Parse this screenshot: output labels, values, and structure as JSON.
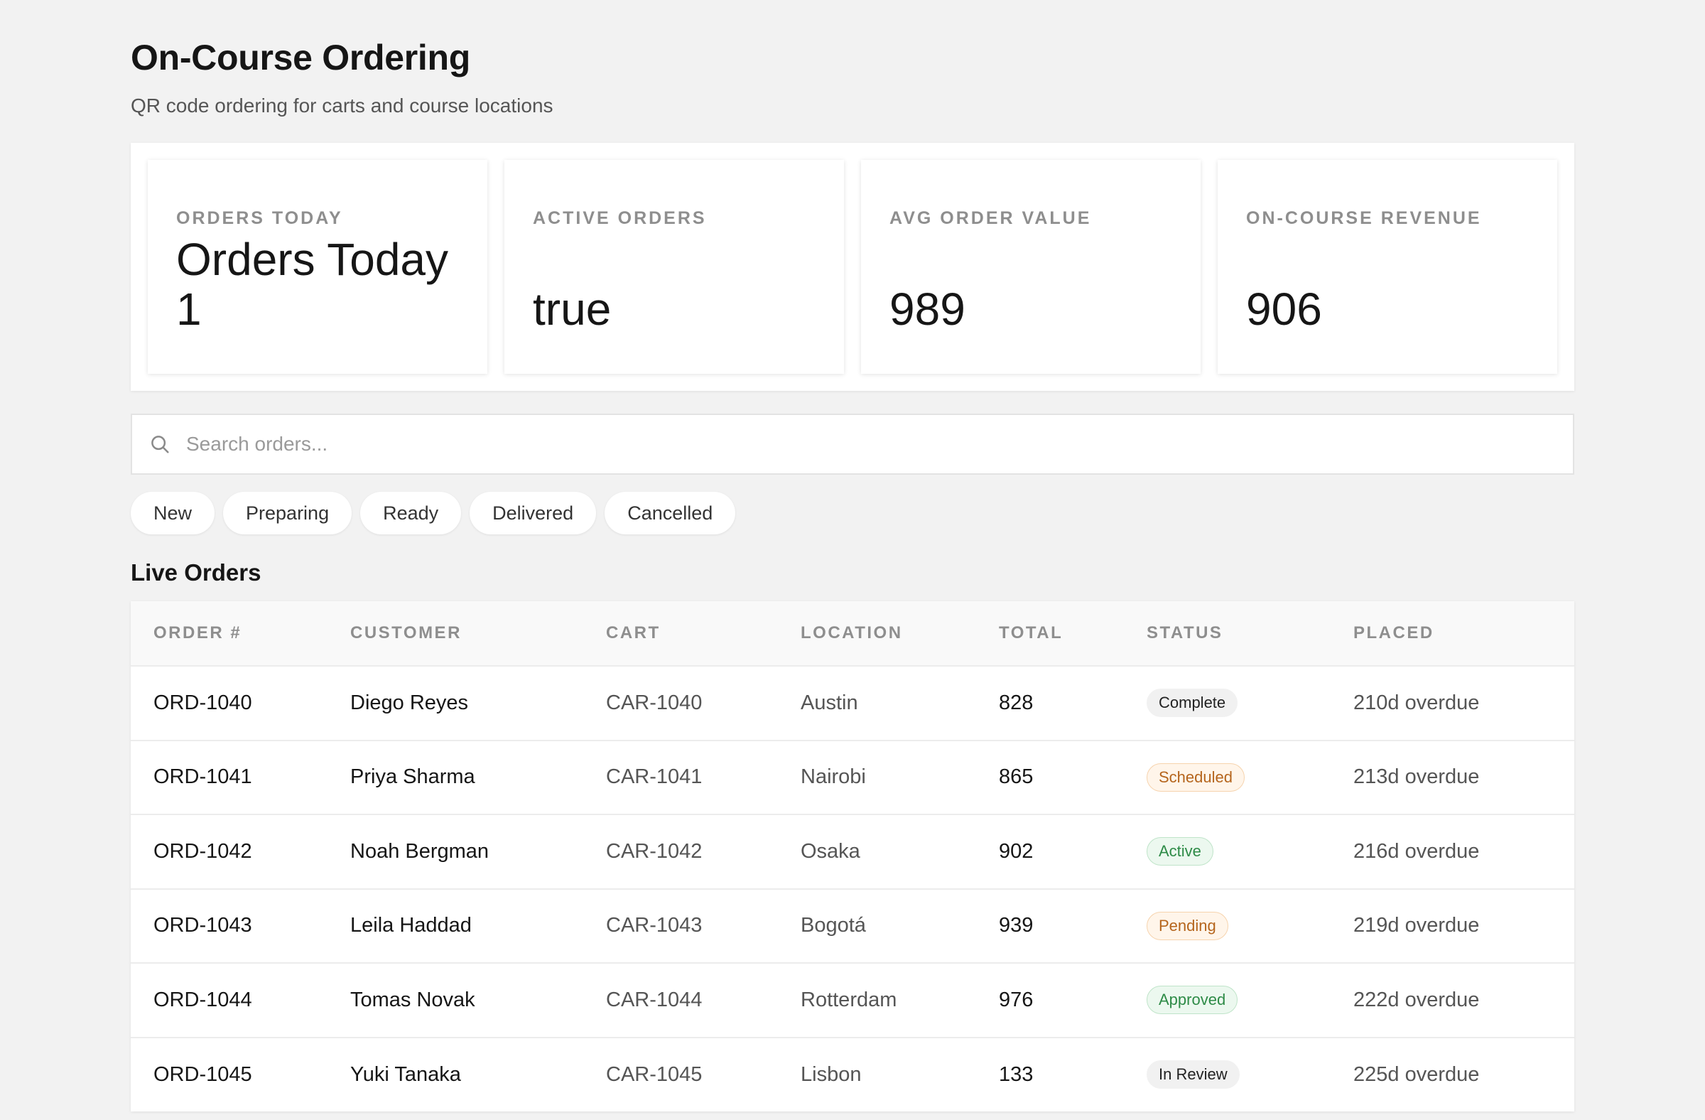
{
  "header": {
    "title": "On-Course Ordering",
    "subtitle": "QR code ordering for carts and course locations"
  },
  "stats": [
    {
      "label": "Orders Today",
      "value": "Orders Today 1"
    },
    {
      "label": "Active Orders",
      "value": "true"
    },
    {
      "label": "Avg Order Value",
      "value": "989"
    },
    {
      "label": "On-Course Revenue",
      "value": "906"
    }
  ],
  "search": {
    "placeholder": "Search orders...",
    "value": ""
  },
  "filters": [
    "New",
    "Preparing",
    "Ready",
    "Delivered",
    "Cancelled"
  ],
  "table": {
    "title": "Live Orders",
    "columns": [
      "Order #",
      "Customer",
      "Cart",
      "Location",
      "Total",
      "Status",
      "Placed"
    ],
    "rows": [
      {
        "order": "ORD-1040",
        "customer": "Diego Reyes",
        "cart": "CAR-1040",
        "location": "Austin",
        "total": "828",
        "status": "Complete",
        "placed": "210d overdue"
      },
      {
        "order": "ORD-1041",
        "customer": "Priya Sharma",
        "cart": "CAR-1041",
        "location": "Nairobi",
        "total": "865",
        "status": "Scheduled",
        "placed": "213d overdue"
      },
      {
        "order": "ORD-1042",
        "customer": "Noah Bergman",
        "cart": "CAR-1042",
        "location": "Osaka",
        "total": "902",
        "status": "Active",
        "placed": "216d overdue"
      },
      {
        "order": "ORD-1043",
        "customer": "Leila Haddad",
        "cart": "CAR-1043",
        "location": "Bogotá",
        "total": "939",
        "status": "Pending",
        "placed": "219d overdue"
      },
      {
        "order": "ORD-1044",
        "customer": "Tomas Novak",
        "cart": "CAR-1044",
        "location": "Rotterdam",
        "total": "976",
        "status": "Approved",
        "placed": "222d overdue"
      },
      {
        "order": "ORD-1045",
        "customer": "Yuki Tanaka",
        "cart": "CAR-1045",
        "location": "Lisbon",
        "total": "133",
        "status": "In Review",
        "placed": "225d overdue"
      }
    ]
  },
  "status_colors": {
    "Complete": {
      "bg": "#f1f1f1",
      "fg": "#222222",
      "border": "#f1f1f1"
    },
    "Scheduled": {
      "bg": "#fff5ea",
      "fg": "#b5651d",
      "border": "#f6d3ad"
    },
    "Active": {
      "bg": "#ecf8ef",
      "fg": "#2e8b47",
      "border": "#bfe4c9"
    },
    "Pending": {
      "bg": "#fff5ea",
      "fg": "#b5651d",
      "border": "#f6d3ad"
    },
    "Approved": {
      "bg": "#ecf8ef",
      "fg": "#2e8b47",
      "border": "#bfe4c9"
    },
    "In Review": {
      "bg": "#f1f1f1",
      "fg": "#222222",
      "border": "#f1f1f1"
    }
  },
  "icons": {
    "search": "search-icon"
  }
}
